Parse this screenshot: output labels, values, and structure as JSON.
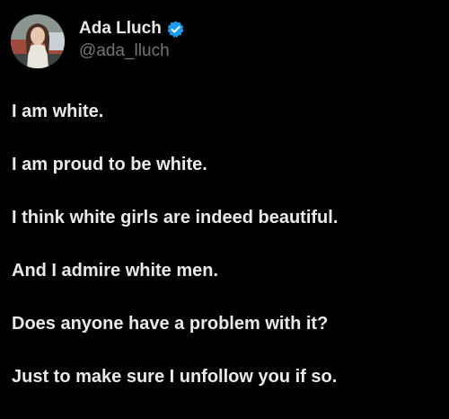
{
  "author": {
    "display_name": "Ada Lluch",
    "handle": "@ada_lluch",
    "verified": true,
    "verified_color": "#1d9bf0",
    "avatar_icon": "profile-photo"
  },
  "post": {
    "paragraphs": [
      "I am white.",
      "I am proud to be white.",
      "I think white girls are indeed beautiful.",
      "And I admire white men.",
      "Does anyone have a problem with it?",
      "Just to make sure I unfollow you if so."
    ]
  },
  "colors": {
    "background": "#000000",
    "primary_text": "#e7e9ea",
    "secondary_text": "#71767b"
  }
}
